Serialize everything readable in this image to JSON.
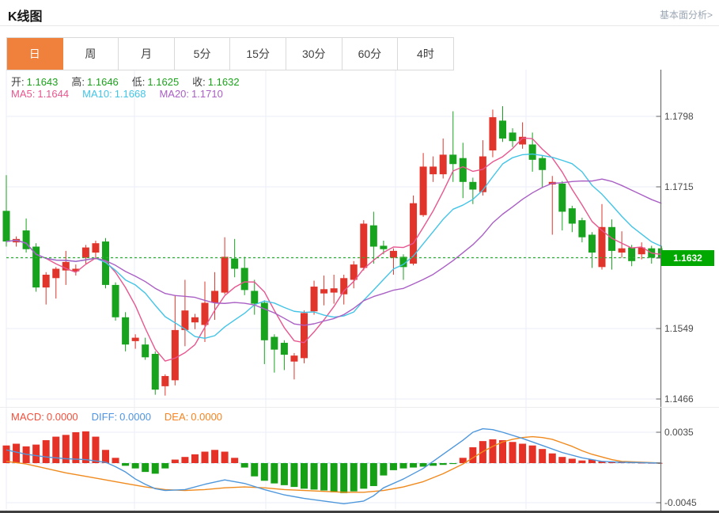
{
  "header": {
    "title": "K线图",
    "link": "基本面分析>"
  },
  "tabs": {
    "items": [
      "日",
      "周",
      "月",
      "5分",
      "15分",
      "30分",
      "60分",
      "4时"
    ],
    "selected_index": 0,
    "active_bg": "#f0813d"
  },
  "legend": {
    "ohlc_row": {
      "value_color": "#1aa31a",
      "items": [
        {
          "label": "开:",
          "value": "1.1643"
        },
        {
          "label": "高:",
          "value": "1.1646"
        },
        {
          "label": "低:",
          "value": "1.1625"
        },
        {
          "label": "收:",
          "value": "1.1632"
        }
      ]
    },
    "ma_row": {
      "items": [
        {
          "label": "MA5:",
          "value": "1.1644",
          "color": "#e8568f"
        },
        {
          "label": "MA10:",
          "value": "1.1668",
          "color": "#43c4e6"
        },
        {
          "label": "MA20:",
          "value": "1.1710",
          "color": "#a95fc4"
        }
      ]
    },
    "macd_row": {
      "items": [
        {
          "label": "MACD:",
          "value": "0.0000",
          "color": "#f0503c"
        },
        {
          "label": "DIFF:",
          "value": "0.0000",
          "color": "#4f94e0"
        },
        {
          "label": "DEA:",
          "value": "0.0000",
          "color": "#f6831f"
        }
      ]
    }
  },
  "price_marker": {
    "value": "1.1632",
    "bg": "#00a800"
  },
  "chart_data": {
    "type": "candlestick+macd",
    "main": {
      "title": "K线图 daily candlestick panel",
      "up_color": "#e1352b",
      "down_color": "#17a31e",
      "grid": true,
      "current_price": 1.1632,
      "current_price_line_color": "#2faf2f",
      "y_axis": {
        "range": [
          1.1466,
          1.1798
        ],
        "ticks": [
          "1.1798",
          "1.1715",
          "1.1632",
          "1.1549",
          "1.1466"
        ],
        "highlight_tick": "1.1632",
        "position": "right"
      },
      "ma_lines": [
        {
          "name": "MA5",
          "period": 5,
          "color": "#e8568f",
          "last_value": 1.1644
        },
        {
          "name": "MA10",
          "period": 10,
          "color": "#43c4e6",
          "last_value": 1.1668
        },
        {
          "name": "MA20",
          "period": 20,
          "color": "#a95fc4",
          "last_value": 1.171
        }
      ],
      "candles_ohlc": [
        [
          1.1687,
          1.1729,
          1.1645,
          1.1651
        ],
        [
          1.165,
          1.1657,
          1.1645,
          1.1654
        ],
        [
          1.1664,
          1.1678,
          1.1638,
          1.1642
        ],
        [
          1.1645,
          1.1649,
          1.1592,
          1.1597
        ],
        [
          1.1597,
          1.1615,
          1.1577,
          1.1612
        ],
        [
          1.1608,
          1.1621,
          1.1584,
          1.1619
        ],
        [
          1.1617,
          1.164,
          1.16,
          1.1627
        ],
        [
          1.1616,
          1.1624,
          1.1611,
          1.1619
        ],
        [
          1.1632,
          1.1647,
          1.1625,
          1.1644
        ],
        [
          1.1638,
          1.1652,
          1.163,
          1.1649
        ],
        [
          1.1651,
          1.1655,
          1.1596,
          1.16
        ],
        [
          1.16,
          1.1603,
          1.1558,
          1.1562
        ],
        [
          1.1562,
          1.1568,
          1.1522,
          1.153
        ],
        [
          1.1534,
          1.1542,
          1.1525,
          1.1538
        ],
        [
          1.153,
          1.1538,
          1.1512,
          1.1515
        ],
        [
          1.1519,
          1.1522,
          1.1471,
          1.1477
        ],
        [
          1.1481,
          1.1495,
          1.147,
          1.1493
        ],
        [
          1.1488,
          1.1588,
          1.1482,
          1.1547
        ],
        [
          1.1547,
          1.1606,
          1.1528,
          1.157
        ],
        [
          1.1556,
          1.1566,
          1.1548,
          1.1562
        ],
        [
          1.1553,
          1.1604,
          1.1533,
          1.1579
        ],
        [
          1.1579,
          1.1615,
          1.1559,
          1.1593
        ],
        [
          1.1591,
          1.1656,
          1.1589,
          1.1633
        ],
        [
          1.1631,
          1.1654,
          1.1609,
          1.1619
        ],
        [
          1.162,
          1.1633,
          1.1588,
          1.1594
        ],
        [
          1.1593,
          1.1606,
          1.1565,
          1.1578
        ],
        [
          1.1579,
          1.1582,
          1.1507,
          1.1535
        ],
        [
          1.1539,
          1.1542,
          1.1497,
          1.1524
        ],
        [
          1.1532,
          1.1535,
          1.15,
          1.1518
        ],
        [
          1.151,
          1.152,
          1.1489,
          1.1517
        ],
        [
          1.1514,
          1.157,
          1.1508,
          1.1567
        ],
        [
          1.1569,
          1.1605,
          1.1565,
          1.1598
        ],
        [
          1.159,
          1.1611,
          1.1576,
          1.1595
        ],
        [
          1.1591,
          1.1612,
          1.1578,
          1.1596
        ],
        [
          1.1589,
          1.1612,
          1.1577,
          1.1608
        ],
        [
          1.1606,
          1.1628,
          1.1596,
          1.1624
        ],
        [
          1.162,
          1.1676,
          1.1617,
          1.1672
        ],
        [
          1.167,
          1.1686,
          1.1625,
          1.1645
        ],
        [
          1.1646,
          1.1652,
          1.1636,
          1.1642
        ],
        [
          1.1632,
          1.1643,
          1.1612,
          1.164
        ],
        [
          1.1633,
          1.1636,
          1.1606,
          1.1621
        ],
        [
          1.1625,
          1.1705,
          1.1623,
          1.1696
        ],
        [
          1.1682,
          1.1755,
          1.168,
          1.1739
        ],
        [
          1.173,
          1.1751,
          1.1721,
          1.1739
        ],
        [
          1.173,
          1.1772,
          1.1725,
          1.1753
        ],
        [
          1.1753,
          1.1804,
          1.1721,
          1.1742
        ],
        [
          1.1749,
          1.1767,
          1.1702,
          1.1721
        ],
        [
          1.1721,
          1.1726,
          1.1695,
          1.1712
        ],
        [
          1.1709,
          1.177,
          1.1705,
          1.1751
        ],
        [
          1.1758,
          1.1806,
          1.175,
          1.1797
        ],
        [
          1.1793,
          1.181,
          1.1768,
          1.1772
        ],
        [
          1.1779,
          1.1784,
          1.1762,
          1.1769
        ],
        [
          1.1765,
          1.1791,
          1.176,
          1.1774
        ],
        [
          1.1765,
          1.1779,
          1.1733,
          1.1747
        ],
        [
          1.1749,
          1.1752,
          1.1714,
          1.1735
        ],
        [
          1.1718,
          1.1728,
          1.1659,
          1.1721
        ],
        [
          1.1719,
          1.1722,
          1.1664,
          1.1686
        ],
        [
          1.169,
          1.1693,
          1.1662,
          1.1672
        ],
        [
          1.1676,
          1.1679,
          1.165,
          1.1656
        ],
        [
          1.1659,
          1.1662,
          1.162,
          1.1638
        ],
        [
          1.1621,
          1.1695,
          1.1618,
          1.1668
        ],
        [
          1.1668,
          1.1677,
          1.1618,
          1.164
        ],
        [
          1.1638,
          1.1663,
          1.1632,
          1.1643
        ],
        [
          1.1644,
          1.1647,
          1.1622,
          1.1628
        ],
        [
          1.1636,
          1.165,
          1.163,
          1.1644
        ],
        [
          1.1643,
          1.1646,
          1.1625,
          1.1632
        ],
        [
          1.1643,
          1.1646,
          1.1625,
          1.1632
        ]
      ]
    },
    "macd": {
      "hist_up_color": "#e63226",
      "hist_down_color": "#16a016",
      "diff_color": "#4e97dc",
      "dea_color": "#f08a1d",
      "zero_line_color": "#b9d9ef",
      "y_axis": {
        "range": [
          -0.0045,
          0.0035
        ],
        "ticks": [
          "0.0035",
          "-0.0045"
        ],
        "position": "right"
      },
      "histogram": [
        0.002,
        0.0022,
        0.0019,
        0.0021,
        0.0026,
        0.003,
        0.0032,
        0.0035,
        0.0036,
        0.003,
        0.0015,
        0.0006,
        -0.0003,
        -0.0006,
        -0.001,
        -0.0012,
        -0.0006,
        0.0004,
        0.0007,
        0.001,
        0.0013,
        0.0015,
        0.0013,
        0.0006,
        -0.0005,
        -0.0015,
        -0.002,
        -0.0023,
        -0.0025,
        -0.0027,
        -0.0029,
        -0.003,
        -0.0031,
        -0.0033,
        -0.0034,
        -0.0032,
        -0.0029,
        -0.0026,
        -0.0014,
        -0.0008,
        -0.0006,
        -0.0005,
        -0.0004,
        -0.0003,
        -0.0002,
        -0.0001,
        0.0006,
        0.0018,
        0.0025,
        0.0027,
        0.0026,
        0.0024,
        0.0022,
        0.002,
        0.0016,
        0.0011,
        0.0007,
        0.0005,
        0.0003,
        0.0004,
        0.0002,
        0.0001,
        0.0001,
        8e-05,
        5e-05,
        3e-05,
        2e-05
      ],
      "diff_points": [
        [
          0,
          0.0015
        ],
        [
          2,
          0.001
        ],
        [
          4,
          0.0007
        ],
        [
          6,
          0.0005
        ],
        [
          8,
          0.0004
        ],
        [
          10,
          0.0001
        ],
        [
          11,
          -0.0004
        ],
        [
          12,
          -0.001
        ],
        [
          13,
          -0.0018
        ],
        [
          14,
          -0.0024
        ],
        [
          15,
          -0.0029
        ],
        [
          16,
          -0.0031
        ],
        [
          18,
          -0.003
        ],
        [
          20,
          -0.0024
        ],
        [
          22,
          -0.0019
        ],
        [
          24,
          -0.0023
        ],
        [
          26,
          -0.003
        ],
        [
          28,
          -0.0036
        ],
        [
          30,
          -0.004
        ],
        [
          32,
          -0.0043
        ],
        [
          34,
          -0.0046
        ],
        [
          36,
          -0.0043
        ],
        [
          37,
          -0.0037
        ],
        [
          38,
          -0.0028
        ],
        [
          40,
          -0.0018
        ],
        [
          42,
          -0.0006
        ],
        [
          44,
          0.001
        ],
        [
          46,
          0.0026
        ],
        [
          47,
          0.0035
        ],
        [
          48,
          0.0039
        ],
        [
          49,
          0.0038
        ],
        [
          50,
          0.0035
        ],
        [
          52,
          0.0028
        ],
        [
          54,
          0.002
        ],
        [
          56,
          0.0012
        ],
        [
          58,
          0.0006
        ],
        [
          60,
          0.0002
        ],
        [
          62,
          0.0001
        ],
        [
          66,
          0.0
        ]
      ],
      "dea_points": [
        [
          0,
          0.0002
        ],
        [
          2,
          -0.0001
        ],
        [
          4,
          -0.0006
        ],
        [
          6,
          -0.0011
        ],
        [
          8,
          -0.0015
        ],
        [
          10,
          -0.0019
        ],
        [
          12,
          -0.0023
        ],
        [
          14,
          -0.0027
        ],
        [
          16,
          -0.003
        ],
        [
          18,
          -0.0031
        ],
        [
          20,
          -0.003
        ],
        [
          22,
          -0.0028
        ],
        [
          24,
          -0.0027
        ],
        [
          26,
          -0.0028
        ],
        [
          28,
          -0.003
        ],
        [
          30,
          -0.0031
        ],
        [
          32,
          -0.0032
        ],
        [
          34,
          -0.0033
        ],
        [
          36,
          -0.0033
        ],
        [
          38,
          -0.0031
        ],
        [
          40,
          -0.0027
        ],
        [
          42,
          -0.0021
        ],
        [
          44,
          -0.0012
        ],
        [
          46,
          -0.0001
        ],
        [
          47,
          0.0006
        ],
        [
          48,
          0.0013
        ],
        [
          49,
          0.0019
        ],
        [
          50,
          0.0024
        ],
        [
          51,
          0.0027
        ],
        [
          52,
          0.0029
        ],
        [
          53,
          0.003
        ],
        [
          54,
          0.0029
        ],
        [
          55,
          0.0027
        ],
        [
          56,
          0.0023
        ],
        [
          57,
          0.0019
        ],
        [
          58,
          0.0014
        ],
        [
          59,
          0.001
        ],
        [
          60,
          0.0007
        ],
        [
          61,
          0.0004
        ],
        [
          62,
          0.0002
        ],
        [
          64,
          0.0001
        ],
        [
          66,
          0.0
        ]
      ]
    }
  }
}
